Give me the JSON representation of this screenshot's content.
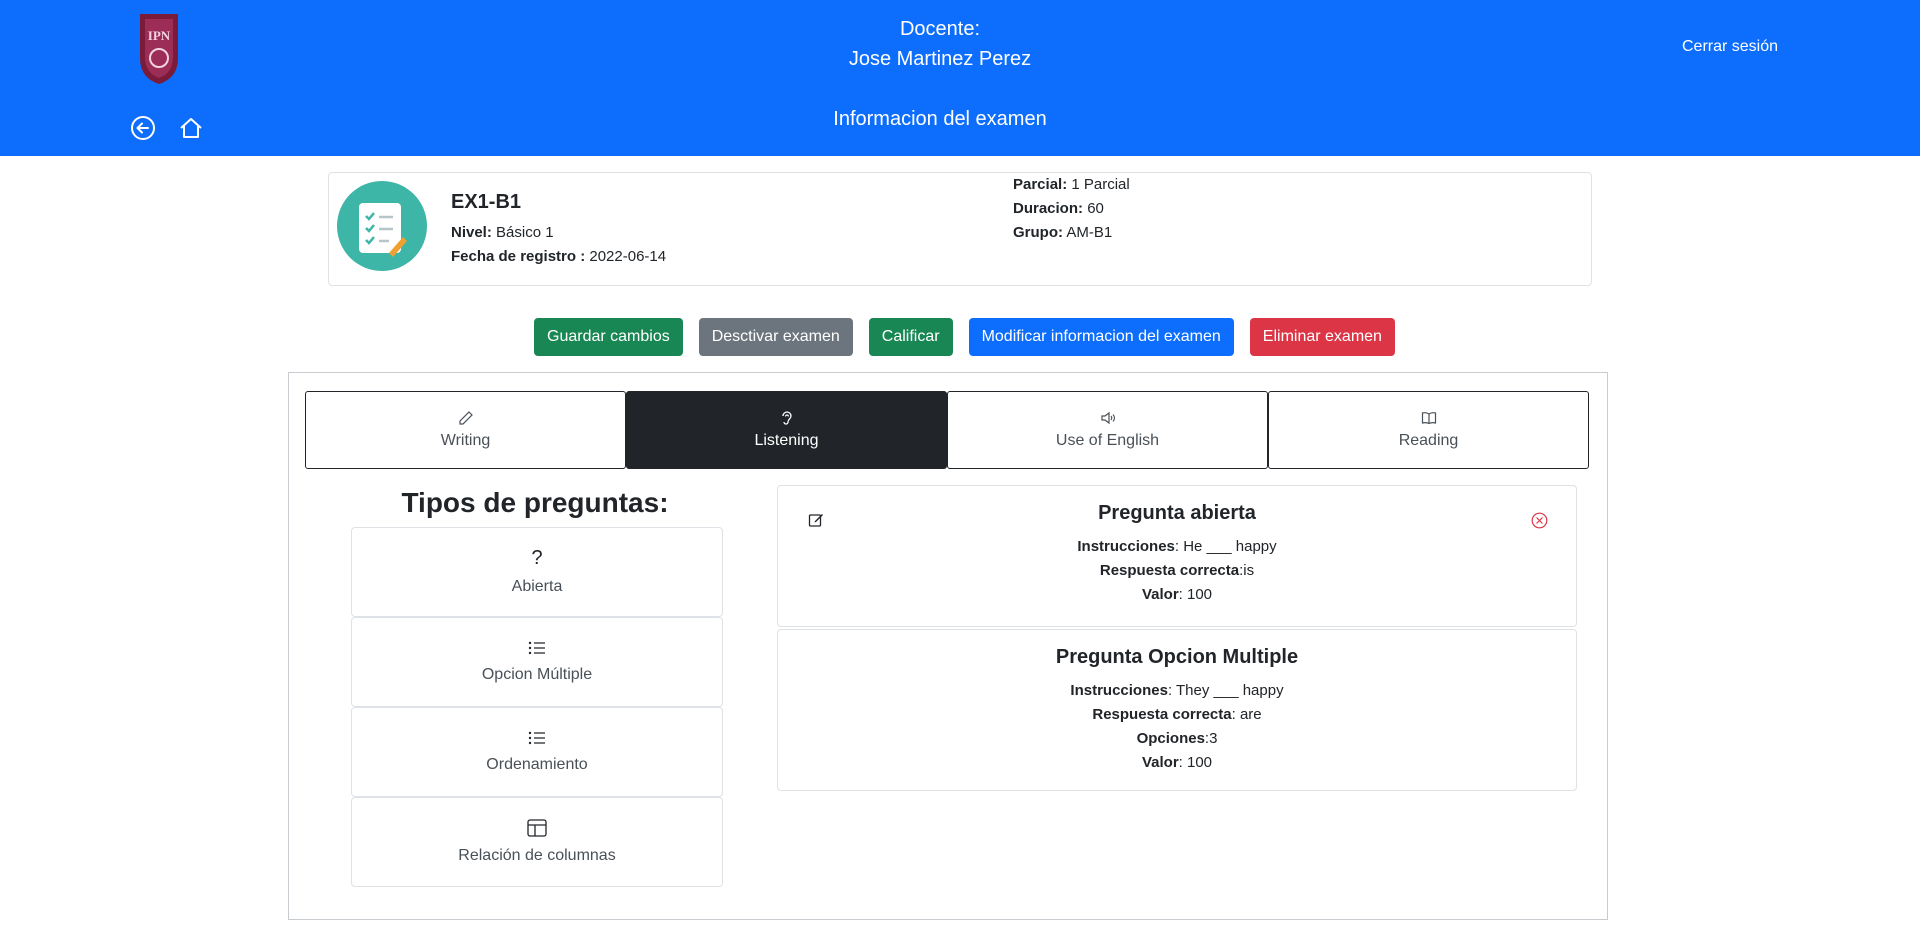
{
  "header": {
    "docente_label": "Docente:",
    "docente_name": "Jose Martinez Perez",
    "logout": "Cerrar sesión",
    "page_title": "Informacion del examen",
    "brand_color": "#0d6efd"
  },
  "exam": {
    "name": "EX1-B1",
    "nivel_label": "Nivel:",
    "nivel": "Básico 1",
    "fecha_label": "Fecha de registro :",
    "fecha": "2022-06-14",
    "parcial_label": "Parcial:",
    "parcial": "1 Parcial",
    "duracion_label": "Duracion:",
    "duracion": "60",
    "grupo_label": "Grupo:",
    "grupo": "AM-B1"
  },
  "actions": {
    "save": "Guardar cambios",
    "deactivate": "Desctivar examen",
    "grade": "Calificar",
    "modify": "Modificar informacion del examen",
    "delete": "Eliminar examen"
  },
  "tabs": [
    {
      "label": "Writing",
      "icon": "pencil-icon"
    },
    {
      "label": "Listening",
      "icon": "ear-icon",
      "active": true
    },
    {
      "label": "Use of English",
      "icon": "speaker-icon"
    },
    {
      "label": "Reading",
      "icon": "book-icon"
    }
  ],
  "question_types": {
    "title": "Tipos de preguntas:",
    "items": [
      {
        "label": "Abierta",
        "icon": "question-mark-icon"
      },
      {
        "label": "Opcion Múltiple",
        "icon": "list-icon"
      },
      {
        "label": "Ordenamiento",
        "icon": "list-icon"
      },
      {
        "label": "Relación de columnas",
        "icon": "layout-columns-icon"
      }
    ]
  },
  "questions": [
    {
      "title": "Pregunta abierta",
      "instr_label": "Instrucciones",
      "instr": ": He ___ happy",
      "answer_label": "Respuesta correcta",
      "answer": ":is",
      "value_label": "Valor",
      "value": ": 100"
    },
    {
      "title": "Pregunta Opcion Multiple",
      "instr_label": "Instrucciones",
      "instr": ": They ___ happy",
      "answer_label": "Respuesta correcta",
      "answer": ": are",
      "options_label": "Opciones",
      "options": ":3",
      "value_label": "Valor",
      "value": ": 100"
    }
  ]
}
